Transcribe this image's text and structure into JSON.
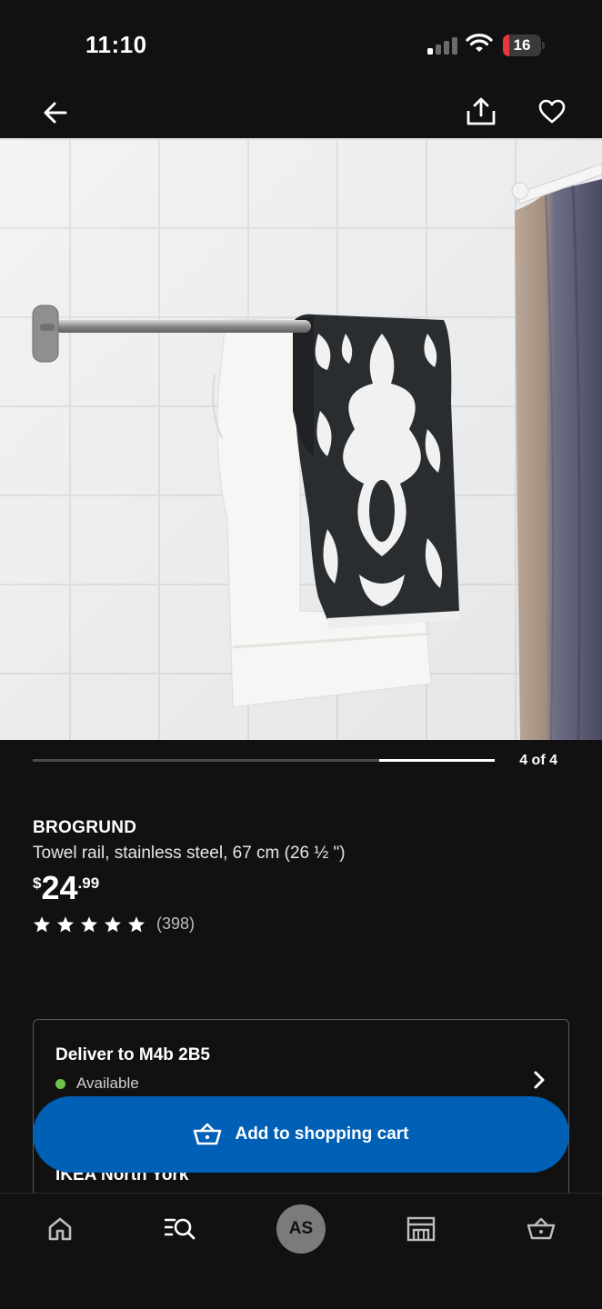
{
  "status_bar": {
    "time": "11:10",
    "battery_level": "16",
    "battery_color": "#e5393b",
    "signal_icon": "cellular-signal-icon",
    "wifi_icon": "wifi-icon"
  },
  "top_bar": {
    "back_icon": "arrow-left-icon",
    "share_icon": "share-icon",
    "favorite_icon": "heart-icon"
  },
  "gallery": {
    "counter": "4 of 4",
    "current_index": 4,
    "total": 4
  },
  "product": {
    "brand": "BROGRUND",
    "description": "Towel rail, stainless steel, 67 cm (26 ½ \")",
    "price_currency": "$",
    "price_whole": "24",
    "price_decimal": ".99",
    "rating_stars": 5,
    "review_count": "(398)"
  },
  "delivery": {
    "title": "Deliver to M4b 2B5",
    "status": "Available",
    "status_color": "#6cc24a",
    "store": "IKEA North York"
  },
  "cart_button": {
    "label": "Add to shopping cart",
    "color": "#0060b6"
  },
  "bottom_nav": {
    "items": [
      "home-icon",
      "search-icon",
      "profile-avatar",
      "store-icon",
      "cart-icon"
    ],
    "avatar_initials": "AS"
  }
}
